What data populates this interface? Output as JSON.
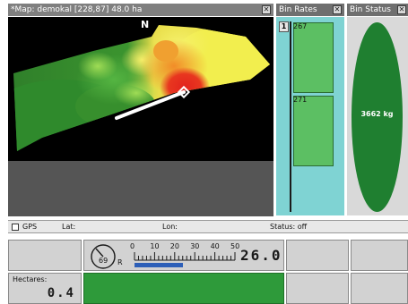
{
  "map_window": {
    "title": "*Map: demokal [228,87] 48.0 ha",
    "north_label": "N",
    "close_label": "✕"
  },
  "bin_rates": {
    "title": "Bin Rates",
    "close_label": "✕",
    "bin_index": "1",
    "rates": [
      "267",
      "271"
    ]
  },
  "bin_status": {
    "title": "Bin Status",
    "close_label": "✕",
    "weight": "3662 kg"
  },
  "status_bar": {
    "gps_label": "GPS",
    "lat_label": "Lat:",
    "lon_label": "Lon:",
    "status": "Status: off"
  },
  "speed_panel": {
    "gauge_value": "69",
    "gauge_letter": "R",
    "scale_ticks": [
      "0",
      "10",
      "20",
      "30",
      "40",
      "50"
    ],
    "digital_readout": "26.0",
    "bar_level_fraction": 0.48
  },
  "hectares": {
    "label": "Hectares:",
    "value": "0.4"
  },
  "colors": {
    "field_dark_green": "#2f8a2c",
    "field_green": "#5cbc3c",
    "field_yellow": "#f2ee4e",
    "field_red": "#e2231e",
    "bin_fill": "#5cbf63",
    "bin_status_ellipse": "#1f7f30",
    "speed_bar": "#2d5fb8"
  }
}
